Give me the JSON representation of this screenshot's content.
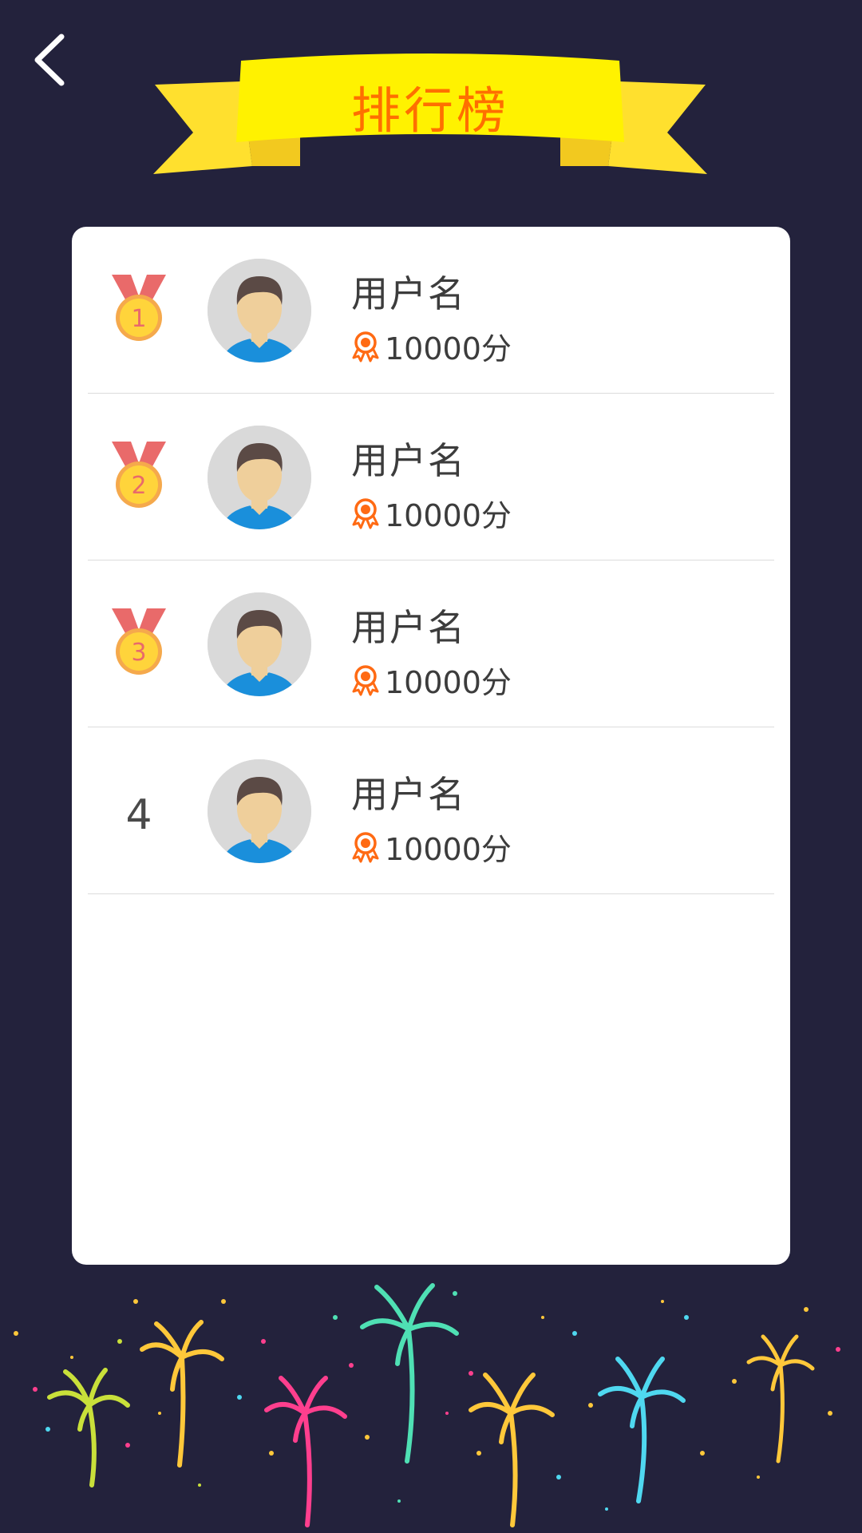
{
  "header": {
    "title": "排行榜",
    "back_icon": "chevron-left-icon"
  },
  "colors": {
    "background": "#23223c",
    "banner_yellow": "#fff200",
    "banner_ribbon": "#ffe02e",
    "title_orange": "#ff6f00",
    "medal_ribbon": "#e96a6a",
    "medal_gold": "#ffd43b",
    "score_icon": "#ff6a13"
  },
  "leaderboard": {
    "entries": [
      {
        "rank": "1",
        "name": "用户名",
        "score": "10000分",
        "badge": "gold-medal-icon"
      },
      {
        "rank": "2",
        "name": "用户名",
        "score": "10000分",
        "badge": "medal-icon"
      },
      {
        "rank": "3",
        "name": "用户名",
        "score": "10000分",
        "badge": "medal-icon"
      },
      {
        "rank": "4",
        "name": "用户名",
        "score": "10000分",
        "badge": ""
      }
    ]
  }
}
